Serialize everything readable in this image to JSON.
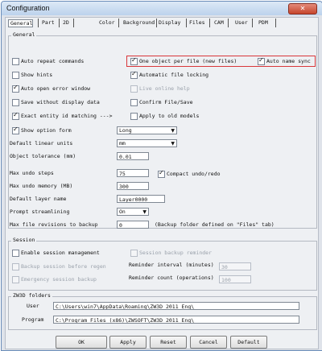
{
  "window": {
    "title": "Configuration",
    "close_glyph": "✕"
  },
  "tabs": [
    {
      "label": "General",
      "selected": true
    },
    {
      "label": "Part"
    },
    {
      "label": "2D"
    },
    {
      "label": "Color"
    },
    {
      "label": "Background"
    },
    {
      "label": "Display"
    },
    {
      "label": "Files"
    },
    {
      "label": "CAM"
    },
    {
      "label": "User"
    },
    {
      "label": "PDM"
    }
  ],
  "general": {
    "group_label": "General",
    "auto_repeat": {
      "label": "Auto repeat commands",
      "checked": false
    },
    "one_object": {
      "label": "One object per file (new files)",
      "checked": true
    },
    "auto_name_sync": {
      "label": "Auto name sync",
      "checked": true
    },
    "show_hints": {
      "label": "Show hints",
      "checked": false
    },
    "auto_file_locking": {
      "label": "Automatic file locking",
      "checked": true
    },
    "auto_open_error": {
      "label": "Auto open error window",
      "checked": true
    },
    "live_online_help": {
      "label": "Live online help",
      "checked": false,
      "disabled": true
    },
    "save_without_display": {
      "label": "Save without display data",
      "checked": false
    },
    "confirm_file_save": {
      "label": "Confirm File/Save",
      "checked": false
    },
    "exact_entity_id": {
      "label": "Exact entity id matching --->",
      "checked": true
    },
    "apply_old_models": {
      "label": "Apply to old models",
      "checked": false
    },
    "show_option_form": {
      "label": "Show option form",
      "checked": true,
      "value": "Long"
    },
    "default_linear_units": {
      "label": "Default linear units",
      "value": "mm"
    },
    "object_tolerance": {
      "label": "Object tolerance (mm)",
      "value": "0.01"
    },
    "max_undo_steps": {
      "label": "Max undo steps",
      "value": "75"
    },
    "compact_undo": {
      "label": "Compact undo/redo",
      "checked": true
    },
    "max_undo_memory": {
      "label": "Max undo memory (MB)",
      "value": "300"
    },
    "default_layer_name": {
      "label": "Default layer name",
      "value": "Layer0000"
    },
    "prompt_streamlining": {
      "label": "Prompt streamlining",
      "value": "On"
    },
    "max_file_revisions": {
      "label": "Max file revisions to backup",
      "value": "0",
      "note": "(Backup folder defined on \"Files\" tab)"
    }
  },
  "session": {
    "group_label": "Session",
    "enable_session": {
      "label": "Enable session management",
      "checked": false
    },
    "session_backup_reminder": {
      "label": "Session backup reminder",
      "checked": false
    },
    "backup_before_regen": {
      "label": "Backup session before regen",
      "checked": false
    },
    "reminder_interval": {
      "label": "Reminder interval (minutes)",
      "value": "30"
    },
    "emergency_backup": {
      "label": "Emergency session backup",
      "checked": false
    },
    "reminder_count": {
      "label": "Reminder count (operations)",
      "value": "100"
    }
  },
  "folders": {
    "group_label": "ZW3D folders",
    "user_label": "User",
    "user_path": "C:\\Users\\win7\\AppData\\Roaming\\ZW3D 2011 Eng\\",
    "program_label": "Program",
    "program_path": "C:\\Program Files (x86)\\ZWSOFT\\ZW3D 2011 Eng\\"
  },
  "buttons": {
    "ok": "OK",
    "apply": "Apply",
    "reset": "Reset",
    "cancel": "Cancel",
    "default": "Default"
  },
  "colors": {
    "highlight": "#d9363a",
    "titlebar": "#bcd2ec"
  }
}
